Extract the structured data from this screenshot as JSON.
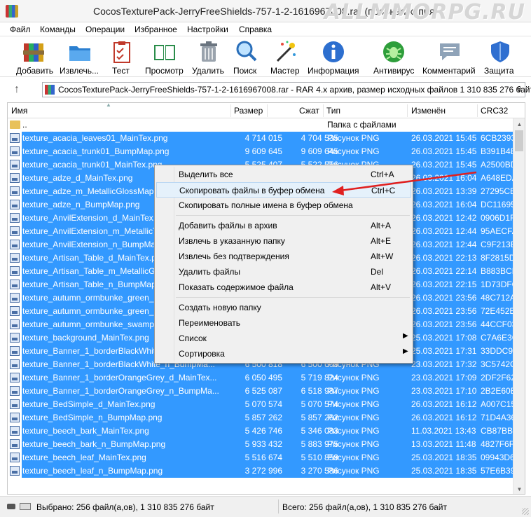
{
  "window": {
    "title": "CocosTexturePack-JerryFreeShields-757-1-2-1616967008.rar (пробная копия)",
    "watermark": "ALLMMORPG.RU"
  },
  "menu": [
    "Файл",
    "Команды",
    "Операции",
    "Избранное",
    "Настройки",
    "Справка"
  ],
  "toolbar": [
    {
      "label": "Добавить",
      "icon": "add-archive-icon"
    },
    {
      "label": "Извлечь...",
      "icon": "extract-folder-icon"
    },
    {
      "label": "Тест",
      "icon": "test-clipboard-icon"
    },
    {
      "label": "Просмотр",
      "icon": "view-book-icon"
    },
    {
      "label": "Удалить",
      "icon": "delete-trash-icon"
    },
    {
      "label": "Поиск",
      "icon": "search-magnifier-icon"
    },
    {
      "label": "Мастер",
      "icon": "wizard-wand-icon"
    },
    {
      "label": "Информация",
      "icon": "info-icon"
    },
    {
      "label": "Антивирус",
      "icon": "antivirus-bug-icon"
    },
    {
      "label": "Комментарий",
      "icon": "comment-icon"
    },
    {
      "label": "Защита",
      "icon": "protect-shield-icon"
    }
  ],
  "path": {
    "text": "CocosTexturePack-JerryFreeShields-757-1-2-1616967008.rar - RAR 4.x архив, размер исходных файлов 1 310 835 276 байт"
  },
  "columns": [
    "Имя",
    "Размер",
    "Сжат",
    "Тип",
    "Изменён",
    "CRC32"
  ],
  "parent_row": {
    "name": "..",
    "type": "Папка с файлами"
  },
  "files": [
    {
      "name": "texture_acacia_leaves01_MainTex.png",
      "size": "4 714 015",
      "packed": "4 704 535",
      "type": "Рисунок PNG",
      "modified": "26.03.2021 15:45",
      "crc": "6CB2393"
    },
    {
      "name": "texture_acacia_trunk01_BumpMap.png",
      "size": "9 609 645",
      "packed": "9 609 645",
      "type": "Рисунок PNG",
      "modified": "26.03.2021 15:45",
      "crc": "B391B4E"
    },
    {
      "name": "texture_acacia_trunk01_MainTex.png",
      "size": "5 525 407",
      "packed": "5 522 556",
      "type": "Рисунок PNG",
      "modified": "26.03.2021 15:45",
      "crc": "A2500BD"
    },
    {
      "name": "texture_adze_d_MainTex.png",
      "size": "",
      "packed": "",
      "type": "",
      "modified": "26.03.2021 16:04",
      "crc": "A648EDA"
    },
    {
      "name": "texture_adze_m_MetallicGlossMap.p",
      "size": "",
      "packed": "",
      "type": "",
      "modified": "26.03.2021 13:39",
      "crc": "27295CB"
    },
    {
      "name": "texture_adze_n_BumpMap.png",
      "size": "",
      "packed": "",
      "type": "",
      "modified": "26.03.2021 16:04",
      "crc": "DC11695"
    },
    {
      "name": "texture_AnvilExtension_d_MainTex.p",
      "size": "",
      "packed": "",
      "type": "",
      "modified": "26.03.2021 12:42",
      "crc": "0906D1F"
    },
    {
      "name": "texture_AnvilExtension_m_MetallicT",
      "size": "",
      "packed": "",
      "type": "",
      "modified": "26.03.2021 12:44",
      "crc": "95AECFA"
    },
    {
      "name": "texture_AnvilExtension_n_BumpMap",
      "size": "",
      "packed": "",
      "type": "",
      "modified": "26.03.2021 12:44",
      "crc": "C9F213B"
    },
    {
      "name": "texture_Artisan_Table_d_MainTex.pn",
      "size": "",
      "packed": "",
      "type": "",
      "modified": "26.03.2021 22:13",
      "crc": "8F2815D"
    },
    {
      "name": "texture_Artisan_Table_m_MetallicGl",
      "size": "",
      "packed": "",
      "type": "",
      "modified": "26.03.2021 22:14",
      "crc": "B883BCE"
    },
    {
      "name": "texture_Artisan_Table_n_BumpMap.",
      "size": "",
      "packed": "",
      "type": "",
      "modified": "26.03.2021 22:15",
      "crc": "1D73DFC"
    },
    {
      "name": "texture_autumn_ormbunke_green_M",
      "size": "",
      "packed": "",
      "type": "",
      "modified": "26.03.2021 23:56",
      "crc": "48C712A"
    },
    {
      "name": "texture_autumn_ormbunke_green_n",
      "size": "",
      "packed": "",
      "type": "",
      "modified": "26.03.2021 23:56",
      "crc": "72E452E"
    },
    {
      "name": "texture_autumn_ormbunke_swamp_",
      "size": "",
      "packed": "",
      "type": "",
      "modified": "26.03.2021 23:56",
      "crc": "44CCF03"
    },
    {
      "name": "texture_background_MainTex.png",
      "size": "",
      "packed": "",
      "type": "",
      "modified": "25.03.2021 17:08",
      "crc": "C7A6E3C"
    },
    {
      "name": "texture_Banner_1_borderBlackWhite",
      "size": "",
      "packed": "",
      "type": "",
      "modified": "25.03.2021 17:31",
      "crc": "33DDC92"
    },
    {
      "name": "texture_Banner_1_borderBlackWhite_n_BumpMa...",
      "size": "6 500 818",
      "packed": "6 500 609",
      "type": "Рисунок PNG",
      "modified": "23.03.2021 17:32",
      "crc": "3C5742C"
    },
    {
      "name": "texture_Banner_1_borderOrangeGrey_d_MainTex...",
      "size": "6 050 495",
      "packed": "5 719 824",
      "type": "Рисунок PNG",
      "modified": "23.03.2021 17:09",
      "crc": "2DF2F62"
    },
    {
      "name": "texture_Banner_1_borderOrangeGrey_n_BumpMa...",
      "size": "6 525 087",
      "packed": "6 518 987",
      "type": "Рисунок PNG",
      "modified": "23.03.2021 17:10",
      "crc": "2B2E60E"
    },
    {
      "name": "texture_BedSimple_d_MainTex.png",
      "size": "5 070 574",
      "packed": "5 070 574",
      "type": "Рисунок PNG",
      "modified": "26.03.2021 16:12",
      "crc": "A007C15"
    },
    {
      "name": "texture_BedSimple_n_BumpMap.png",
      "size": "5 857 262",
      "packed": "5 857 262",
      "type": "Рисунок PNG",
      "modified": "26.03.2021 16:12",
      "crc": "71D4A36"
    },
    {
      "name": "texture_beech_bark_MainTex.png",
      "size": "5 426 746",
      "packed": "5 346 083",
      "type": "Рисунок PNG",
      "modified": "11.03.2021 13:43",
      "crc": "CB87BB6"
    },
    {
      "name": "texture_beech_bark_n_BumpMap.png",
      "size": "5 933 432",
      "packed": "5 883 975",
      "type": "Рисунок PNG",
      "modified": "13.03.2021 11:48",
      "crc": "4827F6F"
    },
    {
      "name": "texture_beech_leaf_MainTex.png",
      "size": "5 516 674",
      "packed": "5 510 859",
      "type": "Рисунок PNG",
      "modified": "25.03.2021 18:35",
      "crc": "09943D6"
    },
    {
      "name": "texture_beech_leaf_n_BumpMap.png",
      "size": "3 272 996",
      "packed": "3 270 586",
      "type": "Рисунок PNG",
      "modified": "25.03.2021 18:35",
      "crc": "57E6B39"
    }
  ],
  "context_menu": {
    "items": [
      {
        "label": "Выделить все",
        "shortcut": "Ctrl+A"
      },
      {
        "label": "Скопировать файлы в буфер обмена",
        "shortcut": "Ctrl+C",
        "highlighted": true
      },
      {
        "label": "Скопировать полные имена в буфер обмена",
        "shortcut": ""
      },
      {
        "sep": true
      },
      {
        "label": "Добавить файлы в архив",
        "shortcut": "Alt+A"
      },
      {
        "label": "Извлечь в указанную папку",
        "shortcut": "Alt+E"
      },
      {
        "label": "Извлечь без подтверждения",
        "shortcut": "Alt+W"
      },
      {
        "label": "Удалить файлы",
        "shortcut": "Del"
      },
      {
        "label": "Показать содержимое файла",
        "shortcut": "Alt+V"
      },
      {
        "sep": true
      },
      {
        "label": "Создать новую папку",
        "shortcut": ""
      },
      {
        "label": "Переименовать",
        "shortcut": ""
      },
      {
        "label": "Список",
        "shortcut": "",
        "submenu": true
      },
      {
        "label": "Сортировка",
        "shortcut": "",
        "submenu": true
      }
    ]
  },
  "status": {
    "left": "Выбрано: 256 файл(а,ов), 1 310 835 276 байт",
    "right": "Всего: 256 файл(а,ов), 1 310 835 276 байт"
  },
  "colors": {
    "selection": "#3399ff",
    "arrow": "#e02020"
  }
}
